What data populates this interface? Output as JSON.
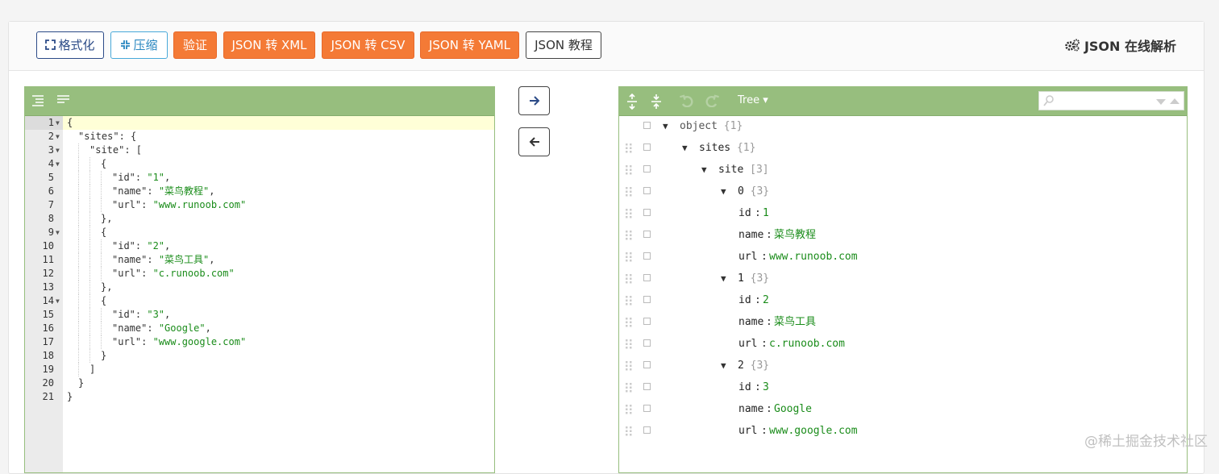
{
  "toolbar": {
    "format_label": "格式化",
    "compress_label": "压缩",
    "validate_label": "验证",
    "to_xml_label": "JSON 转 XML",
    "to_csv_label": "JSON 转 CSV",
    "to_yaml_label": "JSON 转 YAML",
    "tutorial_label": "JSON 教程",
    "title": "JSON 在线解析"
  },
  "colors": {
    "accent_orange": "#f47a36",
    "editor_menu_green": "#97be7e",
    "string_green": "#1a8c1a",
    "primary_blue": "#2c4b87"
  },
  "editor": {
    "active_line": 1,
    "lines": [
      {
        "n": "1",
        "fold": true,
        "indent": 0,
        "tokens": [
          [
            "p",
            "{"
          ]
        ]
      },
      {
        "n": "2",
        "fold": true,
        "indent": 1,
        "tokens": [
          [
            "k",
            "\"sites\""
          ],
          [
            "p",
            ": {"
          ]
        ]
      },
      {
        "n": "3",
        "fold": true,
        "indent": 2,
        "tokens": [
          [
            "k",
            "\"site\""
          ],
          [
            "p",
            ": ["
          ]
        ]
      },
      {
        "n": "4",
        "fold": true,
        "indent": 3,
        "tokens": [
          [
            "p",
            "{"
          ]
        ]
      },
      {
        "n": "5",
        "fold": false,
        "indent": 4,
        "tokens": [
          [
            "k",
            "\"id\""
          ],
          [
            "p",
            ": "
          ],
          [
            "s",
            "\"1\""
          ],
          [
            "p",
            ","
          ]
        ]
      },
      {
        "n": "6",
        "fold": false,
        "indent": 4,
        "tokens": [
          [
            "k",
            "\"name\""
          ],
          [
            "p",
            ": "
          ],
          [
            "s",
            "\"菜鸟教程\""
          ],
          [
            "p",
            ","
          ]
        ]
      },
      {
        "n": "7",
        "fold": false,
        "indent": 4,
        "tokens": [
          [
            "k",
            "\"url\""
          ],
          [
            "p",
            ": "
          ],
          [
            "s",
            "\"www.runoob.com\""
          ]
        ]
      },
      {
        "n": "8",
        "fold": false,
        "indent": 3,
        "tokens": [
          [
            "p",
            "},"
          ]
        ]
      },
      {
        "n": "9",
        "fold": true,
        "indent": 3,
        "tokens": [
          [
            "p",
            "{"
          ]
        ]
      },
      {
        "n": "10",
        "fold": false,
        "indent": 4,
        "tokens": [
          [
            "k",
            "\"id\""
          ],
          [
            "p",
            ": "
          ],
          [
            "s",
            "\"2\""
          ],
          [
            "p",
            ","
          ]
        ]
      },
      {
        "n": "11",
        "fold": false,
        "indent": 4,
        "tokens": [
          [
            "k",
            "\"name\""
          ],
          [
            "p",
            ": "
          ],
          [
            "s",
            "\"菜鸟工具\""
          ],
          [
            "p",
            ","
          ]
        ]
      },
      {
        "n": "12",
        "fold": false,
        "indent": 4,
        "tokens": [
          [
            "k",
            "\"url\""
          ],
          [
            "p",
            ": "
          ],
          [
            "s",
            "\"c.runoob.com\""
          ]
        ]
      },
      {
        "n": "13",
        "fold": false,
        "indent": 3,
        "tokens": [
          [
            "p",
            "},"
          ]
        ]
      },
      {
        "n": "14",
        "fold": true,
        "indent": 3,
        "tokens": [
          [
            "p",
            "{"
          ]
        ]
      },
      {
        "n": "15",
        "fold": false,
        "indent": 4,
        "tokens": [
          [
            "k",
            "\"id\""
          ],
          [
            "p",
            ": "
          ],
          [
            "s",
            "\"3\""
          ],
          [
            "p",
            ","
          ]
        ]
      },
      {
        "n": "16",
        "fold": false,
        "indent": 4,
        "tokens": [
          [
            "k",
            "\"name\""
          ],
          [
            "p",
            ": "
          ],
          [
            "s",
            "\"Google\""
          ],
          [
            "p",
            ","
          ]
        ]
      },
      {
        "n": "17",
        "fold": false,
        "indent": 4,
        "tokens": [
          [
            "k",
            "\"url\""
          ],
          [
            "p",
            ": "
          ],
          [
            "s",
            "\"www.google.com\""
          ]
        ]
      },
      {
        "n": "18",
        "fold": false,
        "indent": 3,
        "tokens": [
          [
            "p",
            "}"
          ]
        ]
      },
      {
        "n": "19",
        "fold": false,
        "indent": 2,
        "tokens": [
          [
            "p",
            "]"
          ]
        ]
      },
      {
        "n": "20",
        "fold": false,
        "indent": 1,
        "tokens": [
          [
            "p",
            "}"
          ]
        ]
      },
      {
        "n": "21",
        "fold": false,
        "indent": 0,
        "tokens": [
          [
            "p",
            "}"
          ]
        ]
      }
    ]
  },
  "tree": {
    "mode_label": "Tree ▾",
    "search_placeholder": "",
    "rows": [
      {
        "level": 0,
        "expand": true,
        "key": "object",
        "count": "{1}",
        "draggable": false
      },
      {
        "level": 1,
        "expand": true,
        "key": "sites",
        "count": "{1}",
        "draggable": true
      },
      {
        "level": 2,
        "expand": true,
        "key": "site",
        "count": "[3]",
        "draggable": true
      },
      {
        "level": 3,
        "expand": true,
        "key": "0",
        "count": "{3}",
        "draggable": true
      },
      {
        "level": 4,
        "expand": false,
        "key": "id",
        "sep": "  :",
        "value": "1",
        "draggable": true
      },
      {
        "level": 4,
        "expand": false,
        "key": "name",
        "sep": ":",
        "value": "菜鸟教程",
        "draggable": true
      },
      {
        "level": 4,
        "expand": false,
        "key": "url",
        "sep": " :",
        "value": "www.runoob.com",
        "draggable": true
      },
      {
        "level": 3,
        "expand": true,
        "key": "1",
        "count": "{3}",
        "draggable": true
      },
      {
        "level": 4,
        "expand": false,
        "key": "id",
        "sep": "  :",
        "value": "2",
        "draggable": true
      },
      {
        "level": 4,
        "expand": false,
        "key": "name",
        "sep": ":",
        "value": "菜鸟工具",
        "draggable": true
      },
      {
        "level": 4,
        "expand": false,
        "key": "url",
        "sep": " :",
        "value": "c.runoob.com",
        "draggable": true
      },
      {
        "level": 3,
        "expand": true,
        "key": "2",
        "count": "{3}",
        "draggable": true
      },
      {
        "level": 4,
        "expand": false,
        "key": "id",
        "sep": "  :",
        "value": "3",
        "draggable": true
      },
      {
        "level": 4,
        "expand": false,
        "key": "name",
        "sep": ":",
        "value": "Google",
        "draggable": true
      },
      {
        "level": 4,
        "expand": false,
        "key": "url",
        "sep": " :",
        "value": "www.google.com",
        "draggable": true
      }
    ]
  },
  "watermark": "@稀土掘金技术社区"
}
